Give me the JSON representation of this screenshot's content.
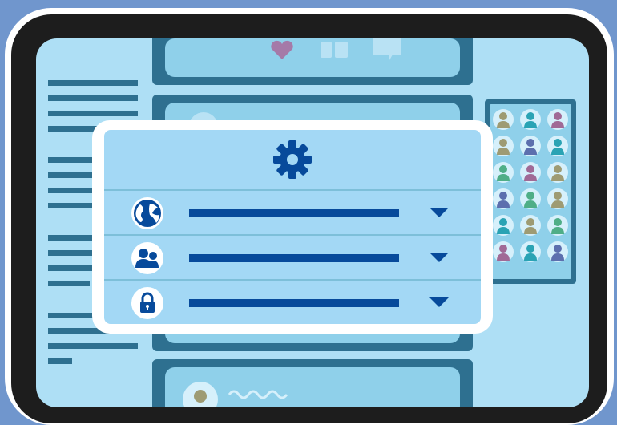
{
  "device": {
    "frame": "tablet"
  },
  "colors": {
    "page_background": "#7096cd",
    "bezel": "#1d1d1d",
    "screen": "#aedff5",
    "accent_dark": "#2e7090",
    "card_fill": "#8fd0ea",
    "settings_panel": "#a3d8f5",
    "icon_blue": "#074a9b"
  },
  "feed": {
    "post_actions": [
      "heart-icon",
      "share-icon",
      "comment-icon"
    ]
  },
  "people_panel": {
    "avatars": [
      {
        "color": "#9e9b73"
      },
      {
        "color": "#2aa3b4"
      },
      {
        "color": "#a06a96"
      },
      {
        "color": "#9e9b73"
      },
      {
        "color": "#5c6fae"
      },
      {
        "color": "#2aa3b4"
      },
      {
        "color": "#4fae87"
      },
      {
        "color": "#a06a96"
      },
      {
        "color": "#9e9b73"
      },
      {
        "color": "#5c6fae"
      },
      {
        "color": "#4fae87"
      },
      {
        "color": "#9e9b73"
      },
      {
        "color": "#2aa3b4"
      },
      {
        "color": "#9e9b73"
      },
      {
        "color": "#4fae87"
      },
      {
        "color": "#a06a96"
      },
      {
        "color": "#2aa3b4"
      },
      {
        "color": "#5c6fae"
      }
    ]
  },
  "settings": {
    "header_icon": "gear-icon",
    "rows": [
      {
        "icon": "globe-icon",
        "value": ""
      },
      {
        "icon": "people-icon",
        "value": ""
      },
      {
        "icon": "lock-icon",
        "value": ""
      }
    ]
  }
}
